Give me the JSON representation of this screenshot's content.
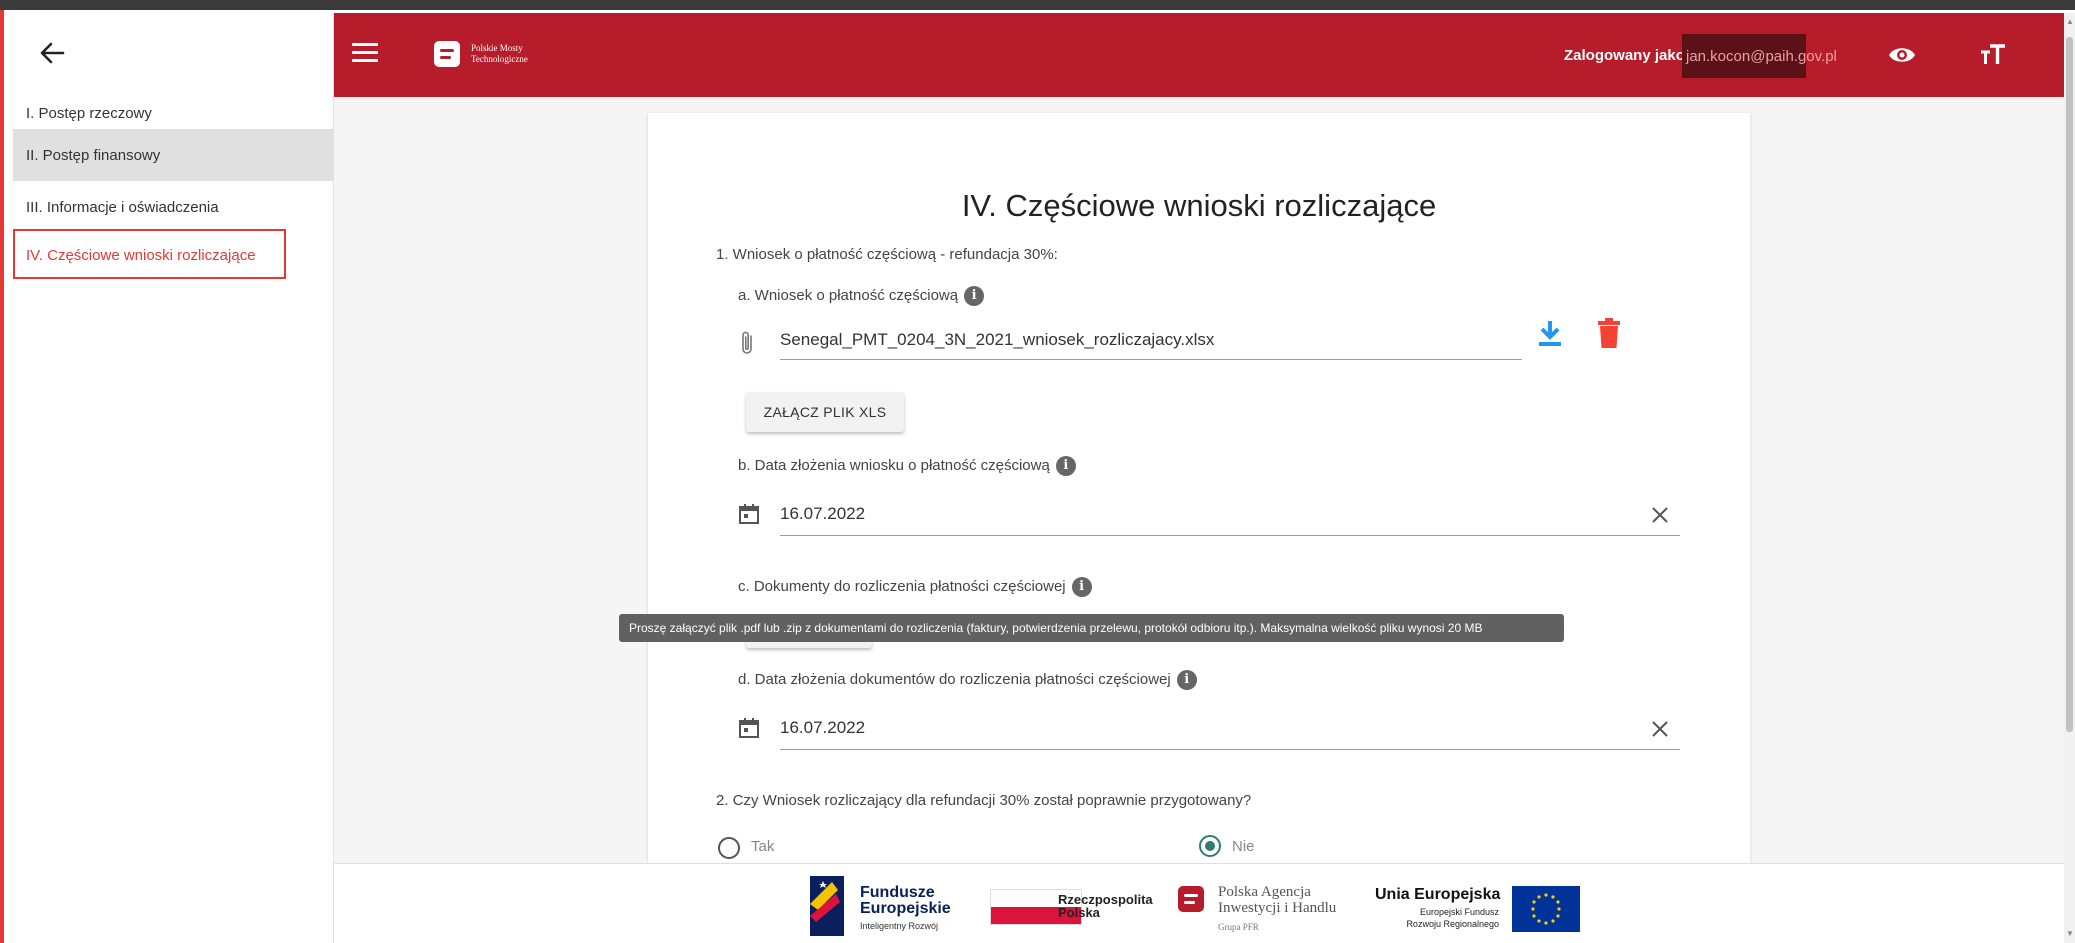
{
  "sidebar": {
    "items": [
      {
        "label": "I. Postęp rzeczowy"
      },
      {
        "label": "II. Postęp finansowy"
      },
      {
        "label": "III. Informacje i oświadczenia"
      },
      {
        "label": "IV. Częściowe wnioski rozliczające"
      }
    ]
  },
  "header": {
    "logo_line1": "Polskie Mosty",
    "logo_line2": "Technologiczne",
    "user_label": "Zalogowany jako:",
    "user_email": "jan.kocon@paih.gov.pl"
  },
  "main": {
    "title": "IV. Częściowe wnioski rozliczające",
    "q1": "1.  Wniosek o płatność częściową - refundacja 30%:",
    "q1a": "a.  Wniosek o płatność częściową",
    "file_name": "Senegal_PMT_0204_3N_2021_wniosek_rozliczajacy.xlsx",
    "attach_xls_label": "ZAŁĄCZ PLIK XLS",
    "q1b": "b.  Data złożenia wniosku o płatność częściową",
    "date_b": "16.07.2022",
    "q1c": "c.  Dokumenty do rozliczenia płatności częściowej",
    "tooltip": "Proszę załączyć plik .pdf lub .zip z dokumentami do rozliczenia (faktury, potwierdzenia przelewu, protokół odbioru itp.). Maksymalna wielkość pliku wynosi 20 MB",
    "q1d": "d.  Data złożenia dokumentów do rozliczenia płatności częściowej",
    "date_d": "16.07.2022",
    "q2": "2.  Czy Wniosek rozliczający dla refundacji 30% został poprawnie przygotowany?",
    "radio_yes": "Tak",
    "radio_no": "Nie",
    "info_glyph": "i"
  },
  "footer": {
    "fe_line1": "Fundusze",
    "fe_line2": "Europejskie",
    "fe_sub": "Inteligentny Rozwój",
    "pl_line1": "Rzeczpospolita",
    "pl_line2": "Polska",
    "paih_line1": "Polska Agencja",
    "paih_line2": "Inwestycji i Handlu",
    "paih_sub": "Grupa PFR",
    "ue_title": "Unia Europejska",
    "ue_sub1": "Europejski Fundusz",
    "ue_sub2": "Rozwoju Regionalnego"
  },
  "colors": {
    "brand_red": "#b71c2b",
    "highlight_red": "#e53935",
    "download_blue": "#2196f3",
    "delete_red": "#f44336",
    "radio_green": "#2e7d6e"
  },
  "icons": [
    "back-arrow-icon",
    "hamburger-icon",
    "eye-icon",
    "font-size-icon",
    "paperclip-icon",
    "download-icon",
    "trash-icon",
    "calendar-icon",
    "close-icon",
    "info-icon"
  ]
}
